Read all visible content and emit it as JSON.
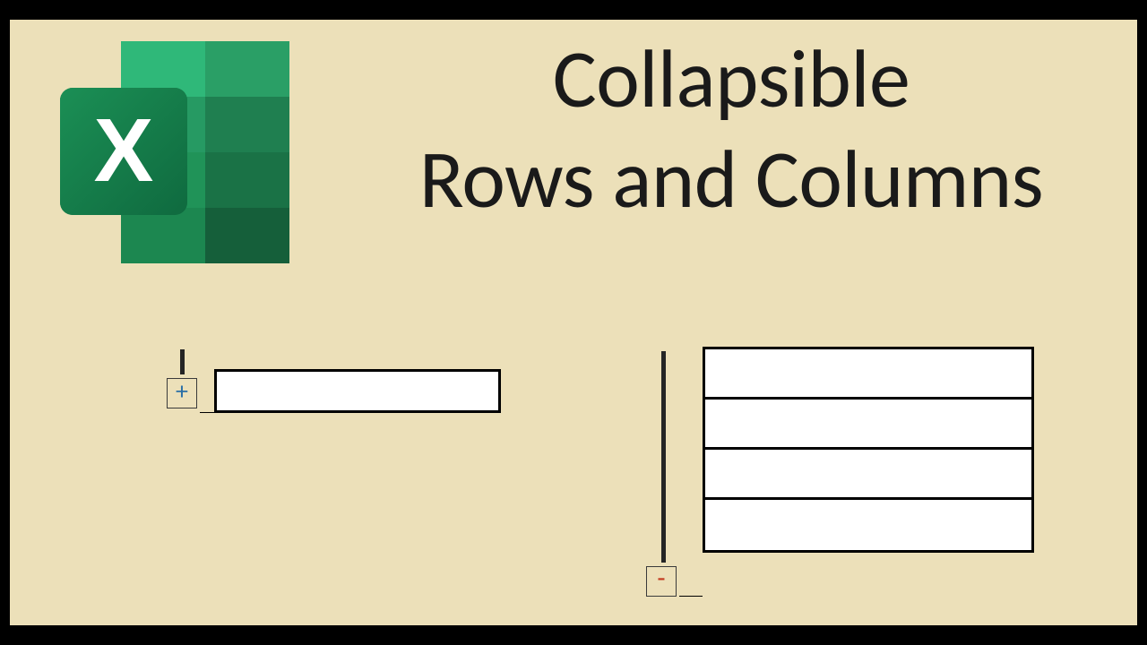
{
  "title": {
    "line1": "Collapsible",
    "line2": "Rows and Columns"
  },
  "icons": {
    "excel_letter": "X",
    "expand_symbol": "+",
    "collapse_symbol": "-"
  },
  "collapsed_group": {
    "visible_rows": 1
  },
  "expanded_group": {
    "visible_rows": 4
  }
}
